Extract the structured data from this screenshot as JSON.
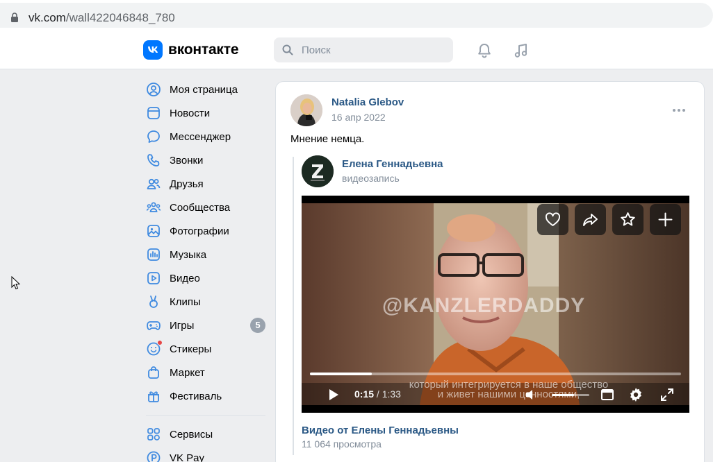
{
  "browser": {
    "url_host": "vk.com",
    "url_path": "/wall422046848_780"
  },
  "header": {
    "logo_text": "вконтакте",
    "search_placeholder": "Поиск"
  },
  "sidebar": {
    "items": [
      {
        "label": "Моя страница",
        "icon": "profile-icon"
      },
      {
        "label": "Новости",
        "icon": "news-icon"
      },
      {
        "label": "Мессенджер",
        "icon": "messenger-icon"
      },
      {
        "label": "Звонки",
        "icon": "phone-icon"
      },
      {
        "label": "Друзья",
        "icon": "friends-icon"
      },
      {
        "label": "Сообщества",
        "icon": "communities-icon"
      },
      {
        "label": "Фотографии",
        "icon": "photos-icon"
      },
      {
        "label": "Музыка",
        "icon": "music-icon"
      },
      {
        "label": "Видео",
        "icon": "video-icon"
      },
      {
        "label": "Клипы",
        "icon": "clips-icon"
      },
      {
        "label": "Игры",
        "icon": "games-icon",
        "badge": "5"
      },
      {
        "label": "Стикеры",
        "icon": "stickers-icon"
      },
      {
        "label": "Маркет",
        "icon": "market-icon"
      },
      {
        "label": "Фестиваль",
        "icon": "festival-icon"
      }
    ],
    "secondary": [
      {
        "label": "Сервисы",
        "icon": "services-icon"
      },
      {
        "label": "VK Pay",
        "icon": "vkpay-icon"
      }
    ]
  },
  "post": {
    "author": "Natalia Glebov",
    "date": "16 апр 2022",
    "text": "Мнение немца.",
    "repost": {
      "author": "Елена Геннадьевна",
      "subtitle": "видеозапись"
    },
    "video": {
      "watermark": "@KANZLERDADDY",
      "subtitle_line1": "который интегрируется в наше общество",
      "subtitle_line2": "и живет нашими ценностями,",
      "current_time": "0:15",
      "separator": " / ",
      "total_time": "1:33",
      "progress": 0.166,
      "volume": 0.6
    },
    "video_title": "Видео от Елены Геннадьевны",
    "views": "11 064 просмотра"
  },
  "colors": {
    "link": "#2a5885",
    "secondary_text": "#818c99",
    "accent": "#0077ff",
    "background": "#edeef0"
  }
}
